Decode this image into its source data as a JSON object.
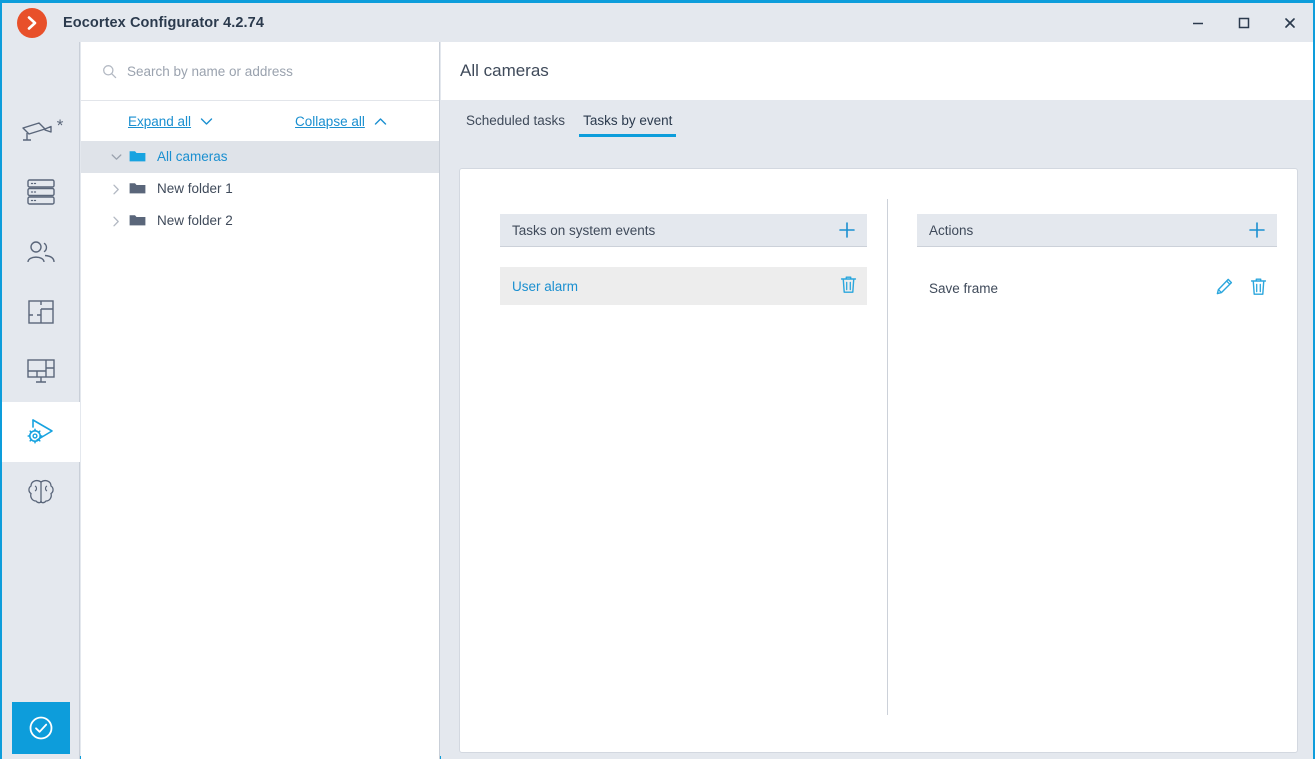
{
  "window": {
    "title": "Eocortex Configurator 4.2.74",
    "logo_icon": "eocortex-chevron-logo",
    "controls": [
      {
        "name": "minimize-button",
        "icon": "minimize-icon"
      },
      {
        "name": "maximize-button",
        "icon": "maximize-icon"
      },
      {
        "name": "close-button",
        "icon": "close-icon"
      }
    ]
  },
  "rail": {
    "items": [
      {
        "name": "sidebar-item-cameras",
        "icon": "camera-icon",
        "badge": "*",
        "active": false
      },
      {
        "name": "sidebar-item-servers",
        "icon": "servers-icon",
        "active": false
      },
      {
        "name": "sidebar-item-users",
        "icon": "users-icon",
        "active": false
      },
      {
        "name": "sidebar-item-plans",
        "icon": "floor-plan-icon",
        "active": false
      },
      {
        "name": "sidebar-item-views",
        "icon": "video-wall-icon",
        "active": false
      },
      {
        "name": "sidebar-item-automation",
        "icon": "automation-gear-play-icon",
        "active": true
      },
      {
        "name": "sidebar-item-analytics",
        "icon": "brain-icon",
        "active": false
      }
    ],
    "apply_button": {
      "name": "apply-button",
      "icon": "check-circle-icon",
      "color": "#0d9ddb"
    }
  },
  "tree_panel": {
    "search": {
      "placeholder": "Search by name or address",
      "value": "",
      "icon": "search-icon"
    },
    "expand_all": {
      "label": "Expand all",
      "icon": "chevron-down-icon"
    },
    "collapse_all": {
      "label": "Collapse all",
      "icon": "chevron-up-icon"
    },
    "nodes": [
      {
        "label": "All cameras",
        "level": 0,
        "expanded": true,
        "selected": true,
        "folder_color": "#17a3e0"
      },
      {
        "label": "New folder 1",
        "level": 1,
        "expanded": false,
        "selected": false,
        "folder_color": "#5a667a"
      },
      {
        "label": "New folder 2",
        "level": 1,
        "expanded": false,
        "selected": false,
        "folder_color": "#5a667a"
      }
    ]
  },
  "main": {
    "page_title": "All cameras",
    "tabs": [
      {
        "label": "Scheduled tasks",
        "active": false
      },
      {
        "label": "Tasks by event",
        "active": true
      }
    ],
    "tasks_section": {
      "title": "Tasks on system events",
      "add_icon": "plus-icon",
      "items": [
        {
          "label": "User alarm",
          "selected": true,
          "delete_icon": "trash-icon"
        }
      ]
    },
    "actions_section": {
      "title": "Actions",
      "add_icon": "plus-icon",
      "items": [
        {
          "label": "Save frame",
          "selected": false,
          "edit_icon": "pencil-icon",
          "delete_icon": "trash-icon"
        }
      ]
    }
  },
  "colors": {
    "accent": "#0d9ddb",
    "link": "#1a8fd0",
    "chrome": "#e4e8ee",
    "logo": "#e8502a",
    "text": "#3f4a5a"
  }
}
